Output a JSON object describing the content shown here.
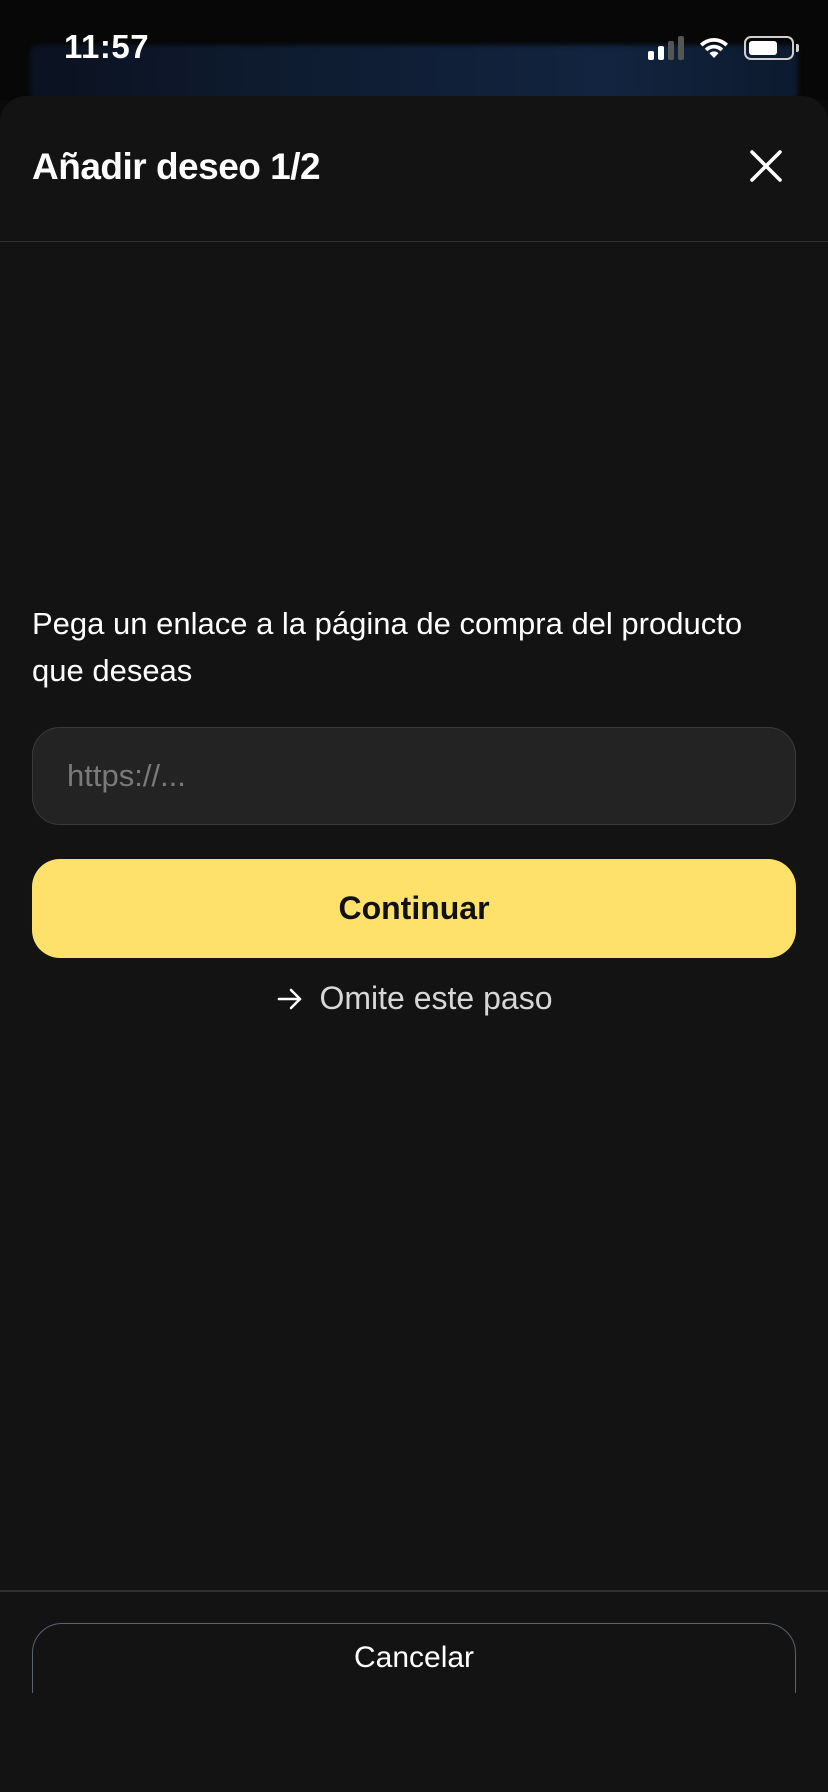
{
  "status_bar": {
    "time": "11:57",
    "icons": [
      "signal-icon",
      "wifi-icon",
      "battery-icon"
    ]
  },
  "sheet": {
    "title": "Añadir deseo 1/2",
    "close_icon": "close-icon"
  },
  "form": {
    "prompt": "Pega un enlace a la página de compra del producto que deseas",
    "url_value": "",
    "url_placeholder": "https://...",
    "continue_label": "Continuar",
    "skip_label": "Omite este paso",
    "skip_icon": "arrow-right-icon"
  },
  "footer": {
    "cancel_label": "Cancelar"
  },
  "colors": {
    "accent": "#fee16a",
    "background": "#131313",
    "input_bg": "#232323"
  }
}
